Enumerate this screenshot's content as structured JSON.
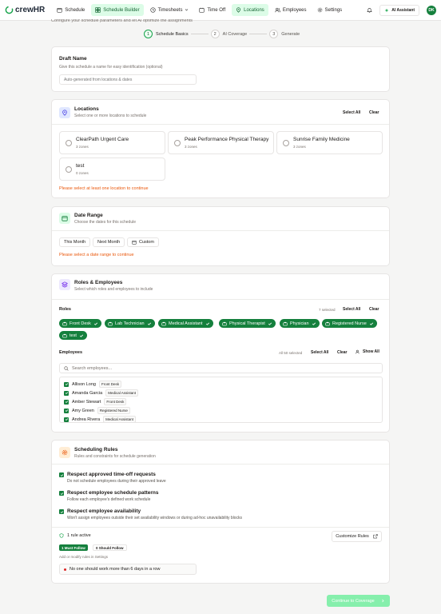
{
  "app": {
    "name": "crewHR"
  },
  "nav": {
    "items": [
      {
        "label": "Schedule",
        "icon": "calendar-icon"
      },
      {
        "label": "Schedule Builder",
        "icon": "grid-icon",
        "active": true
      },
      {
        "label": "Timesheets",
        "icon": "clock-icon",
        "dropdown": true
      },
      {
        "label": "Time Off",
        "icon": "calendar-off-icon"
      },
      {
        "label": "Locations",
        "icon": "map-pin-icon",
        "active": true
      },
      {
        "label": "Employees",
        "icon": "users-icon"
      },
      {
        "label": "Settings",
        "icon": "gear-icon"
      }
    ],
    "ai_assistant": "AI Assistant",
    "avatar_initials": "DK"
  },
  "page": {
    "subtitle": "Configure your schedule parameters and let AI optimize the assignments"
  },
  "steps": [
    {
      "num": "1",
      "label": "Schedule Basics",
      "active": true
    },
    {
      "num": "2",
      "label": "AI Coverage"
    },
    {
      "num": "3",
      "label": "Generate"
    }
  ],
  "draft": {
    "title": "Draft Name",
    "subtitle": "Give this schedule a name for easy identification (optional)",
    "placeholder": "Auto-generated from locations & dates"
  },
  "locations": {
    "title": "Locations",
    "subtitle": "Select one or more locations to schedule",
    "select_all": "Select All",
    "clear": "Clear",
    "items": [
      {
        "name": "ClearPath Urgent Care",
        "zones": "3 zones"
      },
      {
        "name": "Peak Performance Physical Therapy",
        "zones": "3 zones"
      },
      {
        "name": "Sunrise Family Medicine",
        "zones": "3 zones"
      },
      {
        "name": "test",
        "zones": "0 zones"
      }
    ],
    "warning": "Please select at least one location to continue"
  },
  "date_range": {
    "title": "Date Range",
    "subtitle": "Choose the dates for this schedule",
    "this_month": "This Month",
    "next_month": "Next Month",
    "custom": "Custom",
    "warning": "Please select a date range to continue"
  },
  "roles": {
    "title": "Roles & Employees",
    "subtitle": "Select which roles and employees to include",
    "roles_label": "Roles",
    "selected_count": "7 selected",
    "select_all": "Select All",
    "clear": "Clear",
    "chips": [
      "Front Desk",
      "Lab Technician",
      "Medical Assistant",
      "Physical Therapist",
      "Physician",
      "Registered Nurse",
      "test"
    ],
    "employees_label": "Employees",
    "emp_selected": "All 50 selected",
    "emp_select_all": "Select All",
    "emp_clear": "Clear",
    "show_all": "Show All",
    "search_placeholder": "Search employees...",
    "employees": [
      {
        "name": "Allison Long",
        "role": "Front Desk"
      },
      {
        "name": "Amanda Garcia",
        "role": "Medical Assistant"
      },
      {
        "name": "Amber Stewart",
        "role": "Front Desk"
      },
      {
        "name": "Amy Green",
        "role": "Registered Nurse"
      },
      {
        "name": "Andrea Rivera",
        "role": "Medical Assistant"
      }
    ]
  },
  "rules": {
    "title": "Scheduling Rules",
    "subtitle": "Rules and constraints for schedule generation",
    "items": [
      {
        "title": "Respect approved time-off requests",
        "desc": "Do not schedule employees during their approved leave"
      },
      {
        "title": "Respect employee schedule patterns",
        "desc": "Follow each employee's defined work schedule"
      },
      {
        "title": "Respect employee availability",
        "desc": "Won't assign employees outside their set availability windows or during ad-hoc unavailability blocks"
      }
    ],
    "active_count": "1 rule active",
    "must_follow": "1 Must Follow",
    "should_follow": "0 Should Follow",
    "hint": "Add or modify rules in Settings",
    "customize": "Customize Rules",
    "rule_item": "No one should work more than 6 days in a row"
  },
  "continue_label": "Continue to Coverage",
  "colors": {
    "accent": "#15803d",
    "warning": "#ea580c",
    "active_nav": "#dcfce7"
  }
}
